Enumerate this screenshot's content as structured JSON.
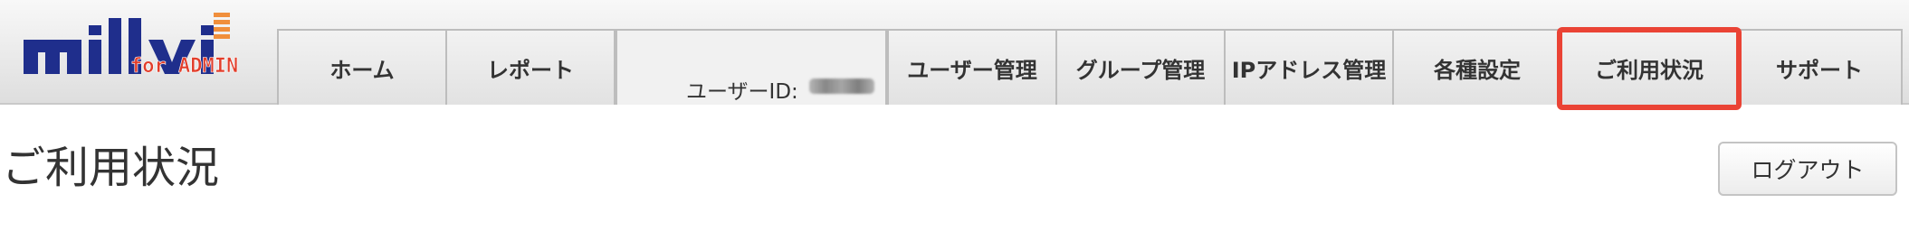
{
  "logo": {
    "brand": "millvi",
    "tagline": "for ADMIN",
    "colors": {
      "primary": "#1f2e8c",
      "accent": "#e23d2a",
      "bars": "#f08f3c"
    }
  },
  "nav": {
    "home": "ホーム",
    "report": "レポート",
    "user_id_label": "ユーザーID:",
    "user_management": "ユーザー管理",
    "group_management": "グループ管理",
    "ip_management": "IPアドレス管理",
    "settings": "各種設定",
    "usage": "ご利用状況",
    "support": "サポート"
  },
  "page": {
    "title": "ご利用状況",
    "logout_label": "ログアウト"
  },
  "highlight": {
    "target": "ご利用状況",
    "color": "#ea4335"
  }
}
